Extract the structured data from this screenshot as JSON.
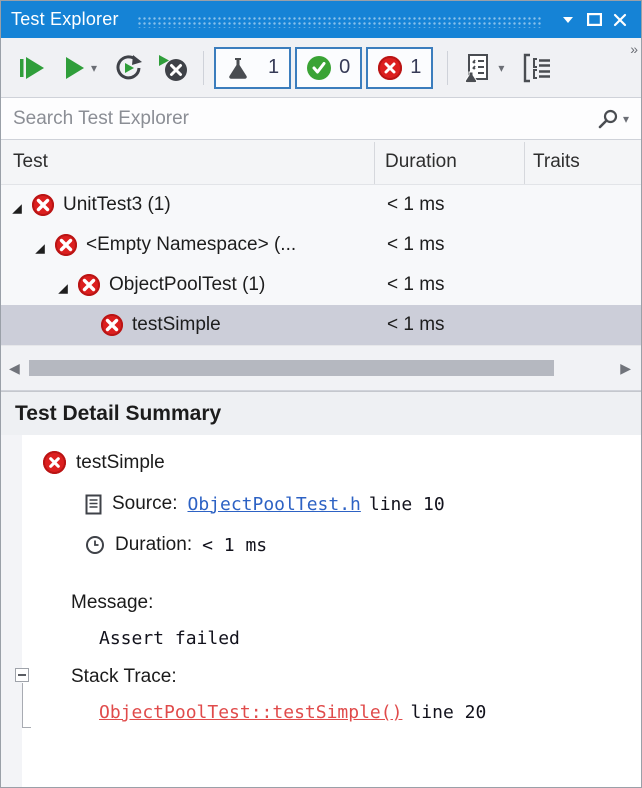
{
  "window": {
    "title": "Test Explorer"
  },
  "toolbar": {
    "counts": {
      "total": "1",
      "passed": "0",
      "failed": "1"
    },
    "icons": {
      "run_all": "green-play-with-bar",
      "run": "green-play",
      "repeat_last_run": "circular-arrow-with-play",
      "run_failed": "play-with-error-circle",
      "total": "beaker-flask",
      "passed": "green-check-circle",
      "failed": "red-x-circle",
      "playlist": "test-playlist-document",
      "group_by": "bracket-group-lines",
      "overflow": "double-chevron"
    }
  },
  "search": {
    "placeholder": "Search Test Explorer"
  },
  "table": {
    "columns": [
      "Test",
      "Duration",
      "Traits"
    ],
    "rows": [
      {
        "name": "UnitTest3 (1)",
        "duration": "< 1 ms"
      },
      {
        "name": "<Empty Namespace> (...",
        "duration": "< 1 ms"
      },
      {
        "name": "ObjectPoolTest (1)",
        "duration": "< 1 ms"
      },
      {
        "name": "testSimple",
        "duration": "< 1 ms"
      }
    ]
  },
  "detail": {
    "header": "Test Detail Summary",
    "test_name": "testSimple",
    "source_label": "Source:",
    "source_link": "ObjectPoolTest.h",
    "source_suffix": "line 10",
    "duration_label": "Duration:",
    "duration_value": "< 1 ms",
    "message_label": "Message:",
    "message_value": "Assert failed",
    "stack_label": "Stack Trace:",
    "stack_link": "ObjectPoolTest::testSimple()",
    "stack_suffix": "line 20"
  },
  "colors": {
    "titlebar_blue": "#1583d6",
    "fail_red": "#dc1f1f",
    "pass_green": "#3aa335",
    "run_green": "#2f9e3a",
    "selection_gray": "#ccced9",
    "count_border_blue": "#3b7dbd",
    "link_blue": "#2d62c4",
    "link_red": "#e04b4b"
  }
}
